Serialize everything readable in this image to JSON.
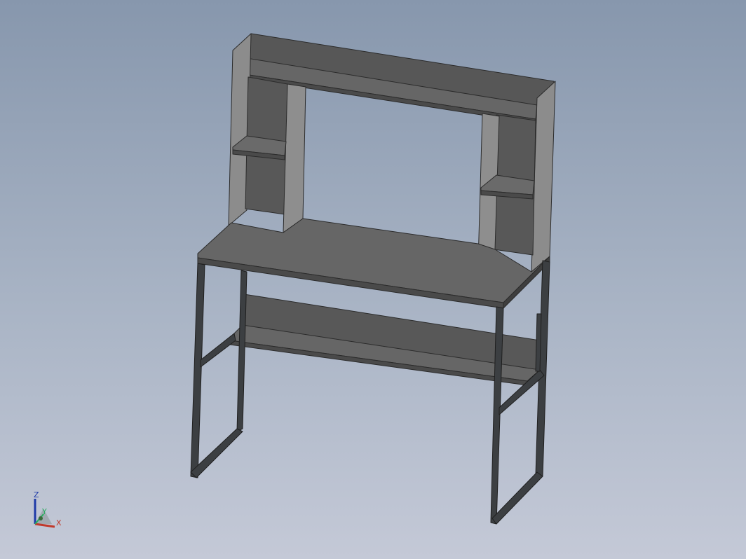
{
  "viewport": {
    "background_top": "#8797ad",
    "background_bottom": "#c4c9d7"
  },
  "model": {
    "kind": "desk with hutch and lower shelf",
    "frame_color": "#3c3f42",
    "panel_colors": [
      "#5a5a5a",
      "#666666",
      "#8c8c8c",
      "#4f4f4f"
    ]
  },
  "triad": {
    "x_label": "X",
    "y_label": "Y",
    "z_label": "Z",
    "x_color": "#c0392b",
    "y_color": "#27ae60",
    "z_color": "#1f3aa8"
  }
}
